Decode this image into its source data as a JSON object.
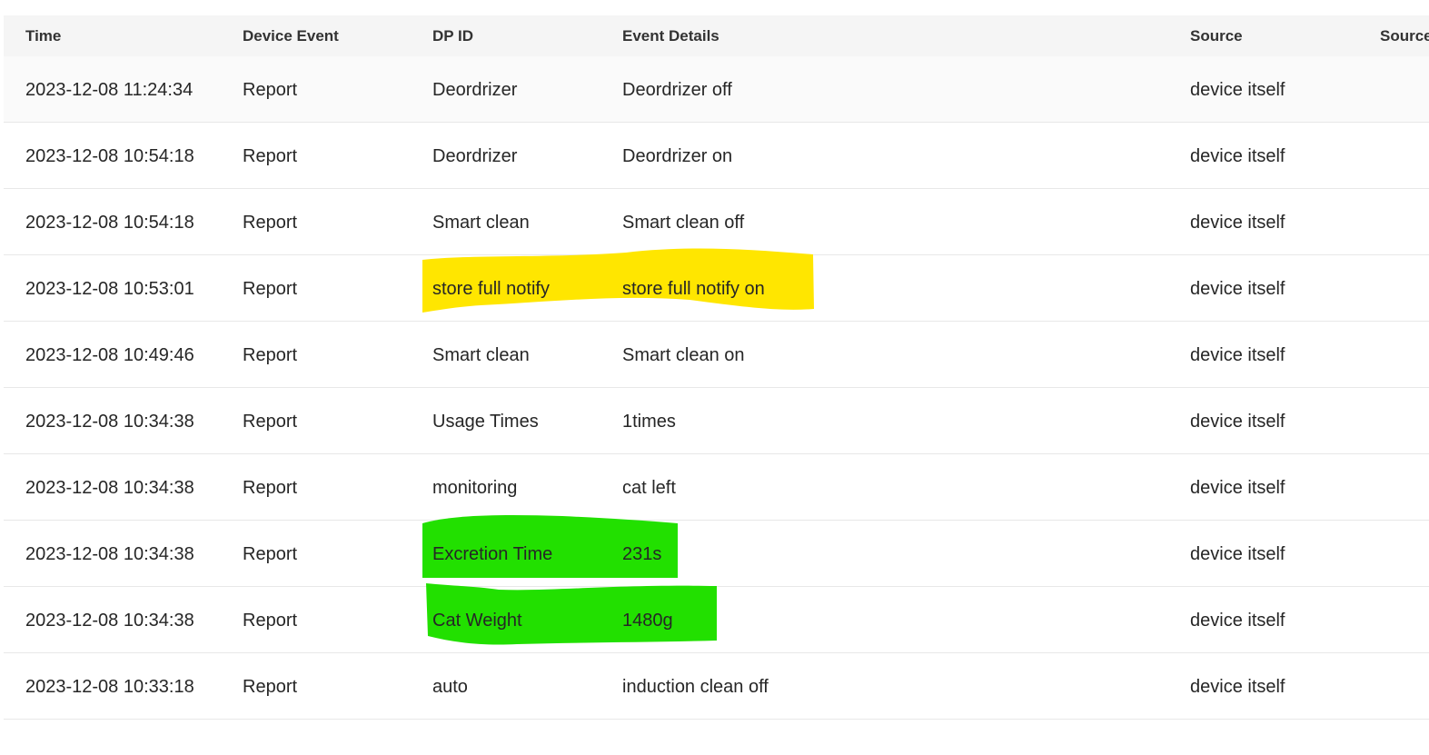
{
  "table": {
    "columns": [
      "Time",
      "Device Event",
      "DP ID",
      "Event Details",
      "Source",
      "Source"
    ],
    "rows": [
      {
        "time": "2023-12-08 11:24:34",
        "event": "Report",
        "dp_id": "Deordrizer",
        "details": "Deordrizer off",
        "source": "device itself"
      },
      {
        "time": "2023-12-08 10:54:18",
        "event": "Report",
        "dp_id": "Deordrizer",
        "details": "Deordrizer on",
        "source": "device itself"
      },
      {
        "time": "2023-12-08 10:54:18",
        "event": "Report",
        "dp_id": "Smart clean",
        "details": "Smart clean off",
        "source": "device itself"
      },
      {
        "time": "2023-12-08 10:53:01",
        "event": "Report",
        "dp_id": "store full notify",
        "details": "store full notify on",
        "source": "device itself"
      },
      {
        "time": "2023-12-08 10:49:46",
        "event": "Report",
        "dp_id": "Smart clean",
        "details": "Smart clean on",
        "source": "device itself"
      },
      {
        "time": "2023-12-08 10:34:38",
        "event": "Report",
        "dp_id": "Usage Times",
        "details": "1times",
        "source": "device itself"
      },
      {
        "time": "2023-12-08 10:34:38",
        "event": "Report",
        "dp_id": "monitoring",
        "details": "cat left",
        "source": "device itself"
      },
      {
        "time": "2023-12-08 10:34:38",
        "event": "Report",
        "dp_id": "Excretion Time",
        "details": "231s",
        "source": "device itself"
      },
      {
        "time": "2023-12-08 10:34:38",
        "event": "Report",
        "dp_id": "Cat Weight",
        "details": "1480g",
        "source": "device itself"
      },
      {
        "time": "2023-12-08 10:33:18",
        "event": "Report",
        "dp_id": "auto",
        "details": "induction clean off",
        "source": "device itself"
      }
    ]
  },
  "highlights": {
    "yellow": "#ffe600",
    "green": "#22e000"
  }
}
